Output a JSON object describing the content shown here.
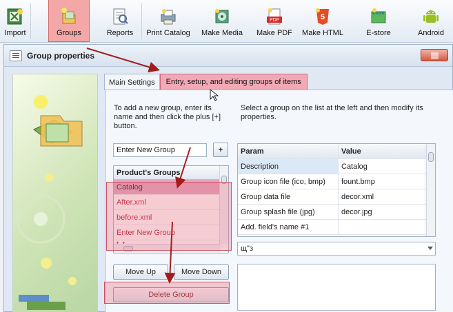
{
  "toolbar": {
    "items": [
      {
        "label": "Import",
        "icon": "import-icon"
      },
      {
        "label": "Groups",
        "icon": "groups-icon"
      },
      {
        "label": "Reports",
        "icon": "reports-icon"
      },
      {
        "label": "Print Catalog",
        "icon": "print-catalog-icon"
      },
      {
        "label": "Make Media",
        "icon": "make-media-icon"
      },
      {
        "label": "Make PDF",
        "icon": "pdf-icon",
        "badge": "PDF"
      },
      {
        "label": "Make HTML",
        "icon": "html5-icon",
        "badge": "5"
      },
      {
        "label": "E-store",
        "icon": "estore-icon",
        "badge": "estore"
      },
      {
        "label": "Android",
        "icon": "android-icon"
      }
    ],
    "active_color": "#f3a7a7"
  },
  "window": {
    "title": "Group properties"
  },
  "tabs": {
    "main": "Main Settings",
    "tooltip": "Entry, setup, and editing groups of items"
  },
  "hints": {
    "left": "To add a new group, enter its name and then click the plus [+] button.",
    "right": "Select a group on the list at the left and then modify its properties."
  },
  "new_group": {
    "value": "Enter New Group",
    "plus": "+"
  },
  "groups_list": {
    "header": "Product's Groups",
    "items": [
      "Catalog",
      "After.xml",
      "before.xml",
      "Enter New Group",
      "t..t"
    ]
  },
  "buttons": {
    "move_up": "Move Up",
    "move_down": "Move Down",
    "delete": "Delete Group"
  },
  "grid": {
    "headers": [
      "Param",
      "Value"
    ],
    "rows": [
      [
        "Description",
        "Catalog"
      ],
      [
        "Group icon file (ico, bmp)",
        "fount.bmp"
      ],
      [
        "Group data file",
        "decor.xml"
      ],
      [
        "Group splash file (jpg)",
        "decor.jpg"
      ],
      [
        "Add. field's name #1",
        ""
      ]
    ]
  },
  "dropdown": {
    "value": "щ\"з"
  },
  "colors": {
    "highlight": "#e26b7e",
    "arrow": "#a31c1c"
  }
}
